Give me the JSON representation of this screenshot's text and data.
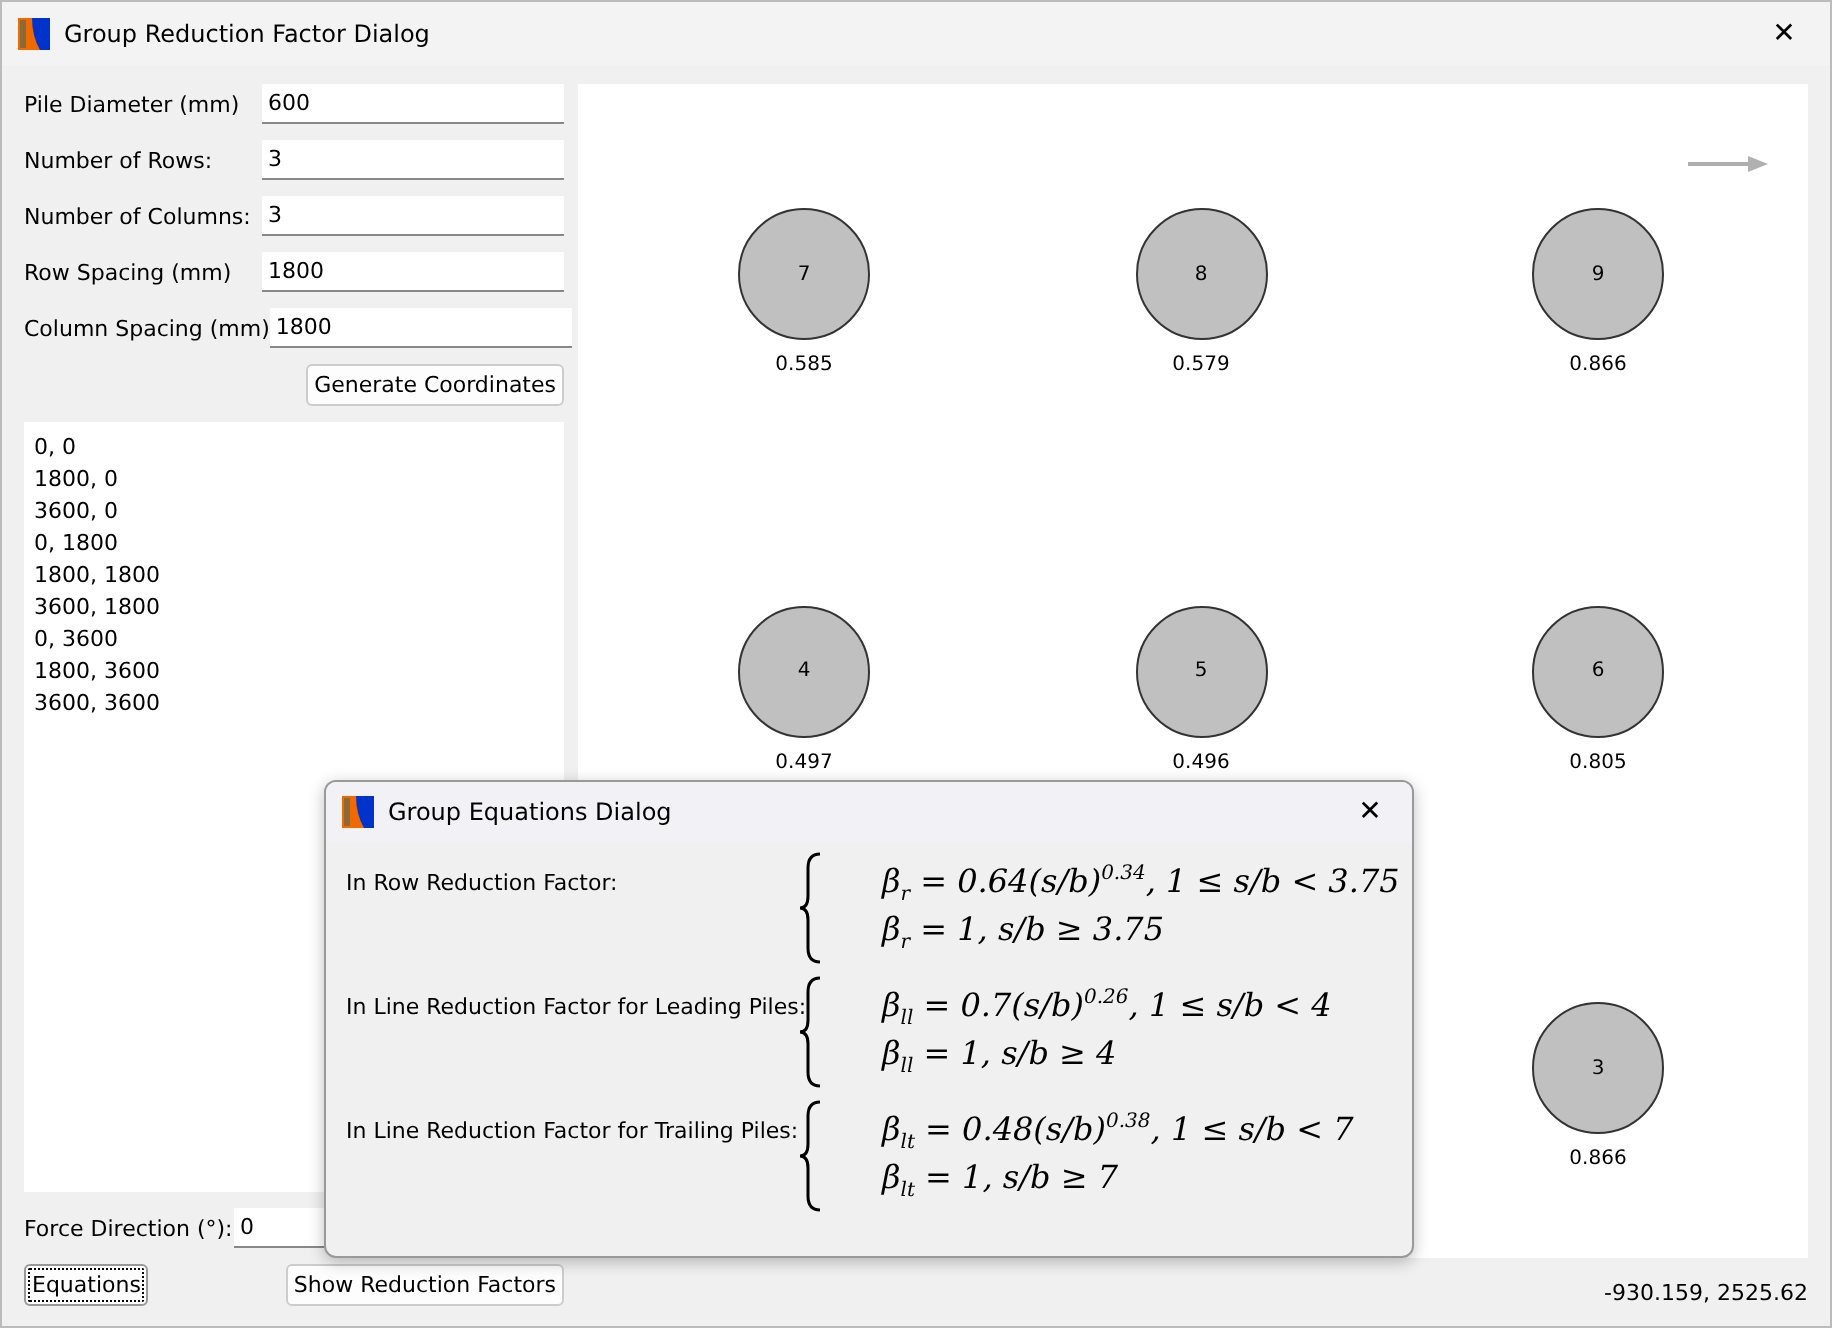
{
  "window": {
    "title": "Group Reduction Factor Dialog",
    "close": "✕"
  },
  "fields": [
    {
      "label": "Pile Diameter (mm)",
      "value": "600"
    },
    {
      "label": "Number of Rows:",
      "value": "3"
    },
    {
      "label": "Number of Columns:",
      "value": "3"
    },
    {
      "label": "Row Spacing (mm)",
      "value": "1800"
    },
    {
      "label": "Column Spacing (mm)",
      "value": "1800"
    }
  ],
  "generate_button": "Generate Coordinates",
  "coordinates": [
    "0, 0",
    "1800, 0",
    "3600, 0",
    "0, 1800",
    "1800, 1800",
    "3600, 1800",
    "0, 3600",
    "1800, 3600",
    "3600, 3600"
  ],
  "force_direction": {
    "label": "Force Direction (°):",
    "value": "0"
  },
  "buttons": {
    "equations": "Equations",
    "show": "Show Reduction Factors"
  },
  "status": "-930.159, 2525.62",
  "piles": [
    {
      "number": "7",
      "factor": "0.585"
    },
    {
      "number": "8",
      "factor": "0.579"
    },
    {
      "number": "9",
      "factor": "0.866"
    },
    {
      "number": "4",
      "factor": "0.497"
    },
    {
      "number": "5",
      "factor": "0.496"
    },
    {
      "number": "6",
      "factor": "0.805"
    },
    {
      "number": "3",
      "factor": "0.866"
    }
  ],
  "equations_dialog": {
    "title": "Group Equations Dialog",
    "close": "✕",
    "groups": [
      {
        "label": "In Row Reduction Factor:",
        "lines": [
          "β$_{r}$ = 0.64(s/b)$^{0.34}$, 1 ≤ s/b < 3.75",
          "β$_{r}$ = 1, s/b ≥ 3.75"
        ]
      },
      {
        "label": "In Line Reduction Factor for Leading Piles:",
        "lines": [
          "β$_{ll}$ = 0.7(s/b)$^{0.26}$, 1 ≤ s/b < 4",
          "β$_{ll}$ = 1, s/b ≥ 4"
        ]
      },
      {
        "label": "In Line Reduction Factor for Trailing Piles:",
        "lines": [
          "β$_{lt}$ = 0.48(s/b)$^{0.38}$, 1 ≤ s/b < 7",
          "β$_{lt}$ = 1, s/b ≥ 7"
        ]
      }
    ]
  }
}
